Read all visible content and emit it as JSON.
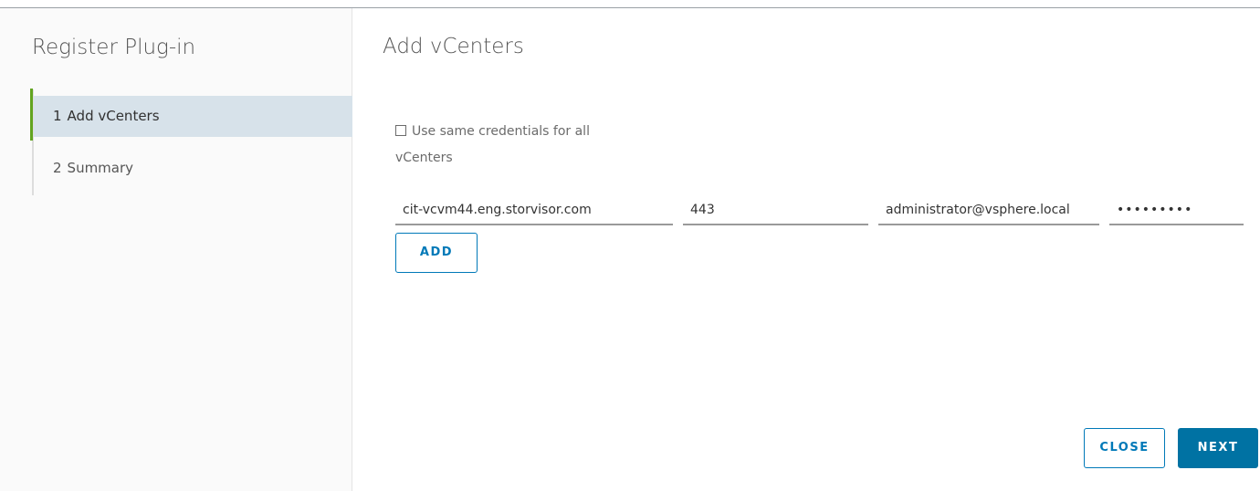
{
  "sidebar": {
    "title": "Register Plug-in",
    "steps": [
      {
        "number": "1",
        "label": "Add vCenters",
        "active": true
      },
      {
        "number": "2",
        "label": "Summary",
        "active": false
      }
    ]
  },
  "main": {
    "title": "Add vCenters",
    "same_credentials": {
      "label": "Use same credentials for all vCenters",
      "checked": false
    },
    "vcenter_row": {
      "host": "cit-vcvm44.eng.storvisor.com",
      "port": "443",
      "username": "administrator@vsphere.local",
      "password_masked": "•••••••••"
    },
    "add_label": "ADD"
  },
  "footer": {
    "close_label": "CLOSE",
    "next_label": "NEXT"
  },
  "colors": {
    "accent": "#0072a3",
    "active_step_bg": "#d7e2ea",
    "active_step_marker": "#62a420"
  }
}
